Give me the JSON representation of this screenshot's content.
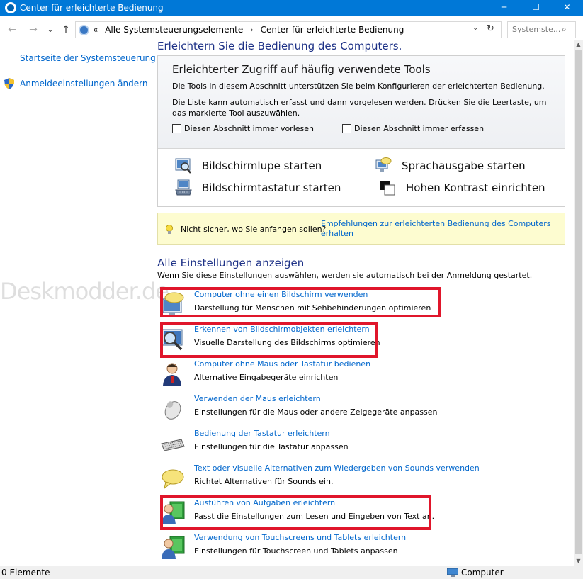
{
  "window": {
    "title": "Center für erleichterte Bedienung",
    "minimize": "─",
    "maximize": "☐",
    "close": "✕"
  },
  "address": {
    "back": "←",
    "forward": "→",
    "recent": "⌄",
    "up": "↑",
    "overflow": "«",
    "crumbs": [
      "Alle Systemsteuerungselemente",
      "Center für erleichterte Bedienung"
    ],
    "separator": "›",
    "dropdown": "⌄",
    "refresh": "↻",
    "search_placeholder": "Systemste...",
    "search_icon": "⌕"
  },
  "sidebar": {
    "home_link": "Startseite der Systemsteuerung",
    "logon_link": "Anmeldeeinstellungen ändern"
  },
  "watermark": "Deskmodder.de",
  "main": {
    "page_title": "Erleichtern Sie die Bedienung des Computers.",
    "quick": {
      "heading": "Erleichterter Zugriff auf häufig verwendete Tools",
      "p1": "Die Tools in diesem Abschnitt unterstützen Sie beim Konfigurieren der erleichterten Bedienung.",
      "p2": "Die Liste kann automatisch erfasst und dann vorgelesen werden. Drücken Sie die Leertaste, um das markierte Tool auszuwählen.",
      "checkbox_read": "Diesen Abschnitt immer vorlesen",
      "checkbox_scan": "Diesen Abschnitt immer erfassen",
      "tools": {
        "magnifier": "Bildschirmlupe starten",
        "narrator": "Sprachausgabe starten",
        "keyboard": "Bildschirmtastatur starten",
        "contrast": "Hohen Kontrast einrichten"
      }
    },
    "hint": {
      "question": "Nicht sicher, wo Sie anfangen sollen?",
      "link": "Empfehlungen zur erleichterten Bedienung des Computers erhalten"
    },
    "all_settings": {
      "title": "Alle Einstellungen anzeigen",
      "desc": "Wenn Sie diese Einstellungen auswählen, werden sie automatisch bei der Anmeldung gestartet.",
      "items": [
        {
          "title": "Computer ohne einen Bildschirm verwenden",
          "desc": "Darstellung für Menschen mit Sehbehinderungen optimieren"
        },
        {
          "title": "Erkennen von Bildschirmobjekten erleichtern",
          "desc": "Visuelle Darstellung des Bildschirms optimieren"
        },
        {
          "title": "Computer ohne Maus oder Tastatur bedienen",
          "desc": "Alternative Eingabegeräte einrichten"
        },
        {
          "title": "Verwenden der Maus erleichtern",
          "desc": "Einstellungen für die Maus oder andere Zeigegeräte anpassen"
        },
        {
          "title": "Bedienung der Tastatur erleichtern",
          "desc": "Einstellungen für die Tastatur anpassen"
        },
        {
          "title": "Text oder visuelle Alternativen zum Wiedergeben von Sounds verwenden",
          "desc": "Richtet Alternativen für Sounds ein."
        },
        {
          "title": "Ausführen von Aufgaben erleichtern",
          "desc": "Passt die Einstellungen zum Lesen und Eingeben von Text an."
        },
        {
          "title": "Verwendung von Touchscreens und Tablets erleichtern",
          "desc": "Einstellungen für Touchscreen und Tablets anpassen"
        }
      ]
    }
  },
  "scrollbar": {
    "up": "▲",
    "down": "▼"
  },
  "status": {
    "count": "0 Elemente",
    "computer": "Computer"
  },
  "colors": {
    "titlebar": "#0078d7",
    "link": "#0066cc",
    "heading": "#1e3287",
    "highlight": "#e0162b",
    "hint_bg": "#fdfcd0"
  }
}
